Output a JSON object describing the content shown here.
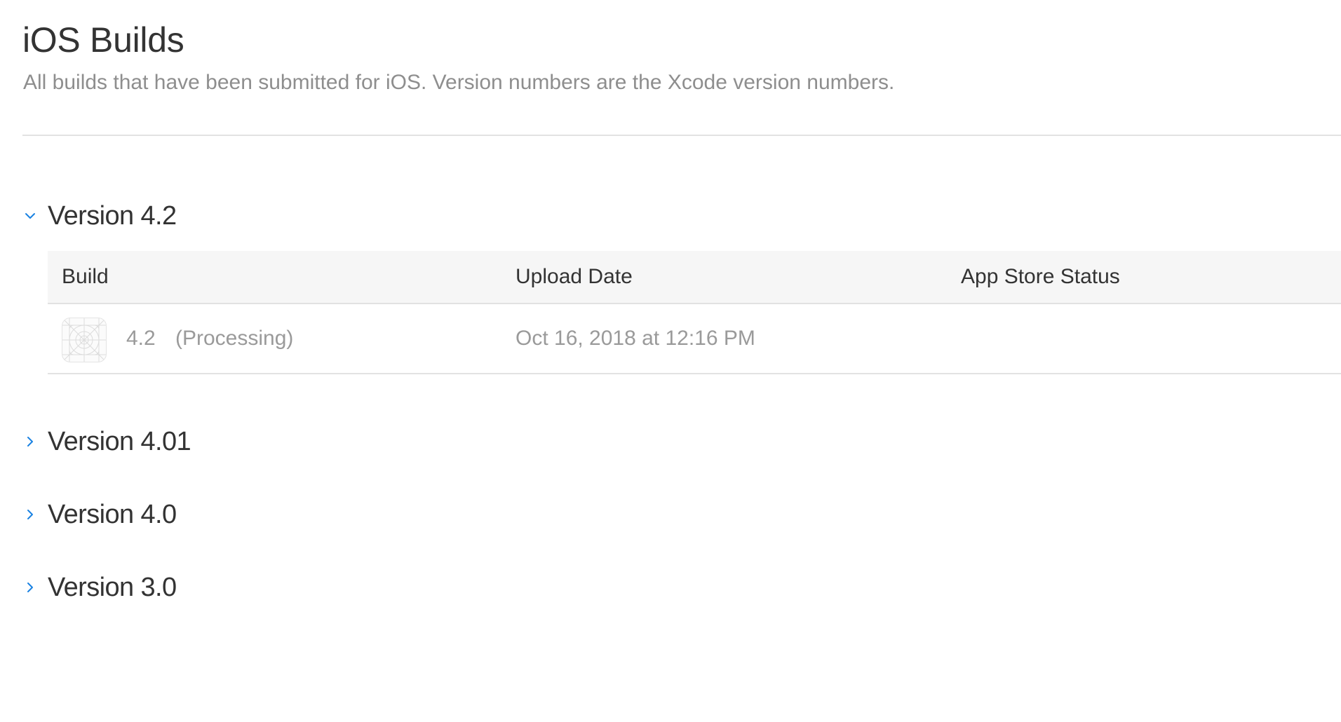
{
  "page": {
    "title": "iOS Builds",
    "subtitle": "All builds that have been submitted for iOS. Version numbers are the Xcode version numbers."
  },
  "versions": [
    {
      "label": "Version 4.2",
      "expanded": true,
      "table": {
        "columns": [
          "Build",
          "Upload Date",
          "App Store Status"
        ],
        "rows": [
          {
            "icon": "app-placeholder-icon",
            "build": "4.2",
            "status_note": "(Processing)",
            "upload_date": "Oct 16, 2018 at 12:16 PM",
            "app_store_status": ""
          }
        ]
      }
    },
    {
      "label": "Version 4.01",
      "expanded": false
    },
    {
      "label": "Version 4.0",
      "expanded": false
    },
    {
      "label": "Version 3.0",
      "expanded": false
    }
  ],
  "colors": {
    "accent": "#1a82e2",
    "title_text": "#333333",
    "muted_text": "#8e8e8e",
    "divider": "#e2e2e2",
    "table_header_bg": "#f6f6f6"
  }
}
